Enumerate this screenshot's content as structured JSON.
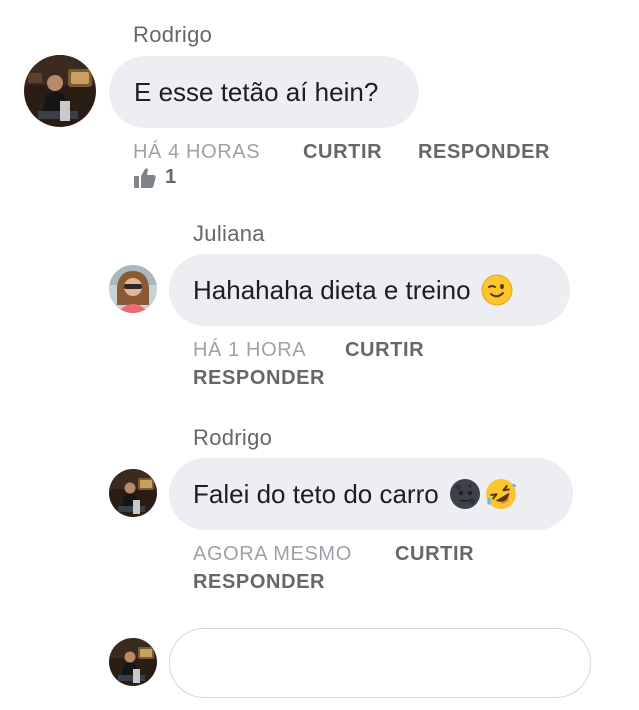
{
  "comments": [
    {
      "author": "Rodrigo",
      "text": "E esse tetão aí hein?",
      "time": "HÁ 4 HORAS",
      "like_label": "CURTIR",
      "reply_label": "RESPONDER",
      "like_count": "1"
    },
    {
      "author": "Juliana",
      "text": "Hahahaha dieta e treino",
      "emojis": [
        "winking-face-emoji"
      ],
      "time": "HÁ 1 HORA",
      "like_label": "CURTIR",
      "reply_label": "RESPONDER"
    },
    {
      "author": "Rodrigo",
      "text": "Falei do teto do carro",
      "emojis": [
        "new-moon-face-emoji",
        "rolling-on-floor-laughing-emoji"
      ],
      "time": "AGORA MESMO",
      "like_label": "CURTIR",
      "reply_label": "RESPONDER"
    }
  ],
  "composer": {
    "placeholder": ""
  },
  "colors": {
    "bubble": "#eceef2",
    "text": "#1c1e21",
    "meta": "#65676b",
    "time": "#9ea2a8"
  }
}
